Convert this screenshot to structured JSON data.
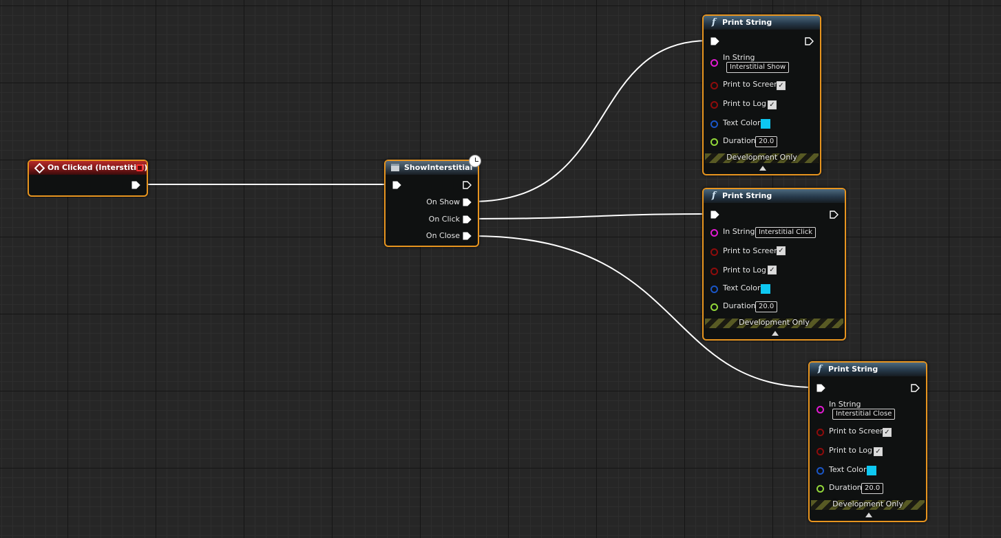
{
  "graph": {
    "event_node": {
      "title": "On Clicked (Interstitial)"
    },
    "show_node": {
      "title": "ShowInterstitial",
      "outputs": [
        "On Show",
        "On Click",
        "On Close"
      ]
    },
    "print_nodes": [
      {
        "title": "Print String",
        "in_string_label": "In String",
        "in_string_value": "Interstitial Show",
        "print_to_screen_label": "Print to Screen",
        "print_to_screen_checked": true,
        "print_to_log_label": "Print to Log",
        "print_to_log_checked": true,
        "text_color_label": "Text Color",
        "text_color": "#0ec8f2",
        "duration_label": "Duration",
        "duration_value": "20.0",
        "footer": "Development Only"
      },
      {
        "title": "Print String",
        "in_string_label": "In String",
        "in_string_value": "Interstitial Click",
        "print_to_screen_label": "Print to Screen",
        "print_to_screen_checked": true,
        "print_to_log_label": "Print to Log",
        "print_to_log_checked": true,
        "text_color_label": "Text Color",
        "text_color": "#0ec8f2",
        "duration_label": "Duration",
        "duration_value": "20.0",
        "footer": "Development Only"
      },
      {
        "title": "Print String",
        "in_string_label": "In String",
        "in_string_value": "Interstitial Close",
        "print_to_screen_label": "Print to Screen",
        "print_to_screen_checked": true,
        "print_to_log_label": "Print to Log",
        "print_to_log_checked": true,
        "text_color_label": "Text Color",
        "text_color": "#0ec8f2",
        "duration_label": "Duration",
        "duration_value": "20.0",
        "footer": "Development Only"
      }
    ]
  },
  "pin_colors": {
    "exec": "#ffffff",
    "string": "#e21ad2",
    "bool": "#8e0c0c",
    "struct": "#1a56c8",
    "float": "#93d83a"
  }
}
